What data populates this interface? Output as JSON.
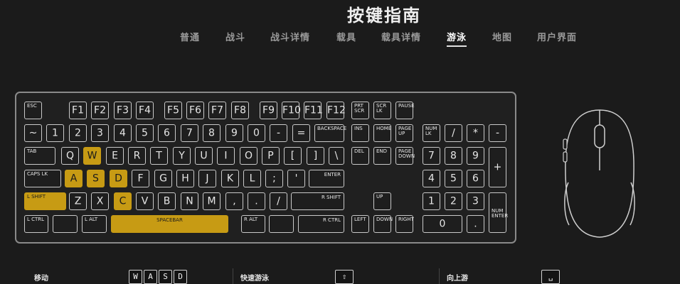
{
  "page": {
    "title": "按键指南"
  },
  "tabs": [
    {
      "label": "普通",
      "active": false
    },
    {
      "label": "战斗",
      "active": false
    },
    {
      "label": "战斗详情",
      "active": false
    },
    {
      "label": "载具",
      "active": false
    },
    {
      "label": "载具详情",
      "active": false
    },
    {
      "label": "游泳",
      "active": true
    },
    {
      "label": "地图",
      "active": false
    },
    {
      "label": "用户界面",
      "active": false
    }
  ],
  "colors": {
    "highlight": "#c79b14",
    "background": "#1b1b1b",
    "key_border": "#c9c9c9"
  },
  "keyboard": {
    "highlighted": [
      "W",
      "A",
      "S",
      "D",
      "C",
      "L SHIFT",
      "SPACEBAR"
    ],
    "keys": [
      "ESC",
      "F1",
      "F2",
      "F3",
      "F4",
      "F5",
      "F6",
      "F7",
      "F8",
      "F9",
      "F10",
      "F11",
      "F12",
      "PRT\nSCR",
      "SCR\nLK",
      "PAUSE",
      "~",
      "1",
      "2",
      "3",
      "4",
      "5",
      "6",
      "7",
      "8",
      "9",
      "0",
      "-",
      "=",
      "BACKSPACE",
      "INS",
      "HOME",
      "PAGE\nUP",
      "NUM\nLK",
      "/",
      "*",
      "-",
      "TAB",
      "Q",
      "W",
      "E",
      "R",
      "T",
      "Y",
      "U",
      "I",
      "O",
      "P",
      "[",
      "]",
      "\\",
      "DEL",
      "END",
      "PAGE\nDOWN",
      "7",
      "8",
      "9",
      "+",
      "CAPS LK",
      "A",
      "S",
      "D",
      "F",
      "G",
      "H",
      "J",
      "K",
      "L",
      ";",
      "'",
      "ENTER",
      "4",
      "5",
      "6",
      "L SHIFT",
      "Z",
      "X",
      "C",
      "V",
      "B",
      "N",
      "M",
      ",",
      ".",
      "/",
      "R SHIFT",
      "UP",
      "1",
      "2",
      "3",
      "NUM\nENTER",
      "L CTRL",
      "",
      "L ALT",
      "SPACEBAR",
      "R ALT",
      "",
      "R CTRL",
      "LEFT",
      "DOWN",
      "RIGHT",
      "0",
      "."
    ]
  },
  "bindings": [
    {
      "action": "移动",
      "keys": [
        "W",
        "A",
        "S",
        "D"
      ]
    },
    {
      "action": "快速游泳",
      "keys": [
        "⇧"
      ]
    },
    {
      "action": "向上游",
      "keys": [
        "␣"
      ]
    }
  ]
}
